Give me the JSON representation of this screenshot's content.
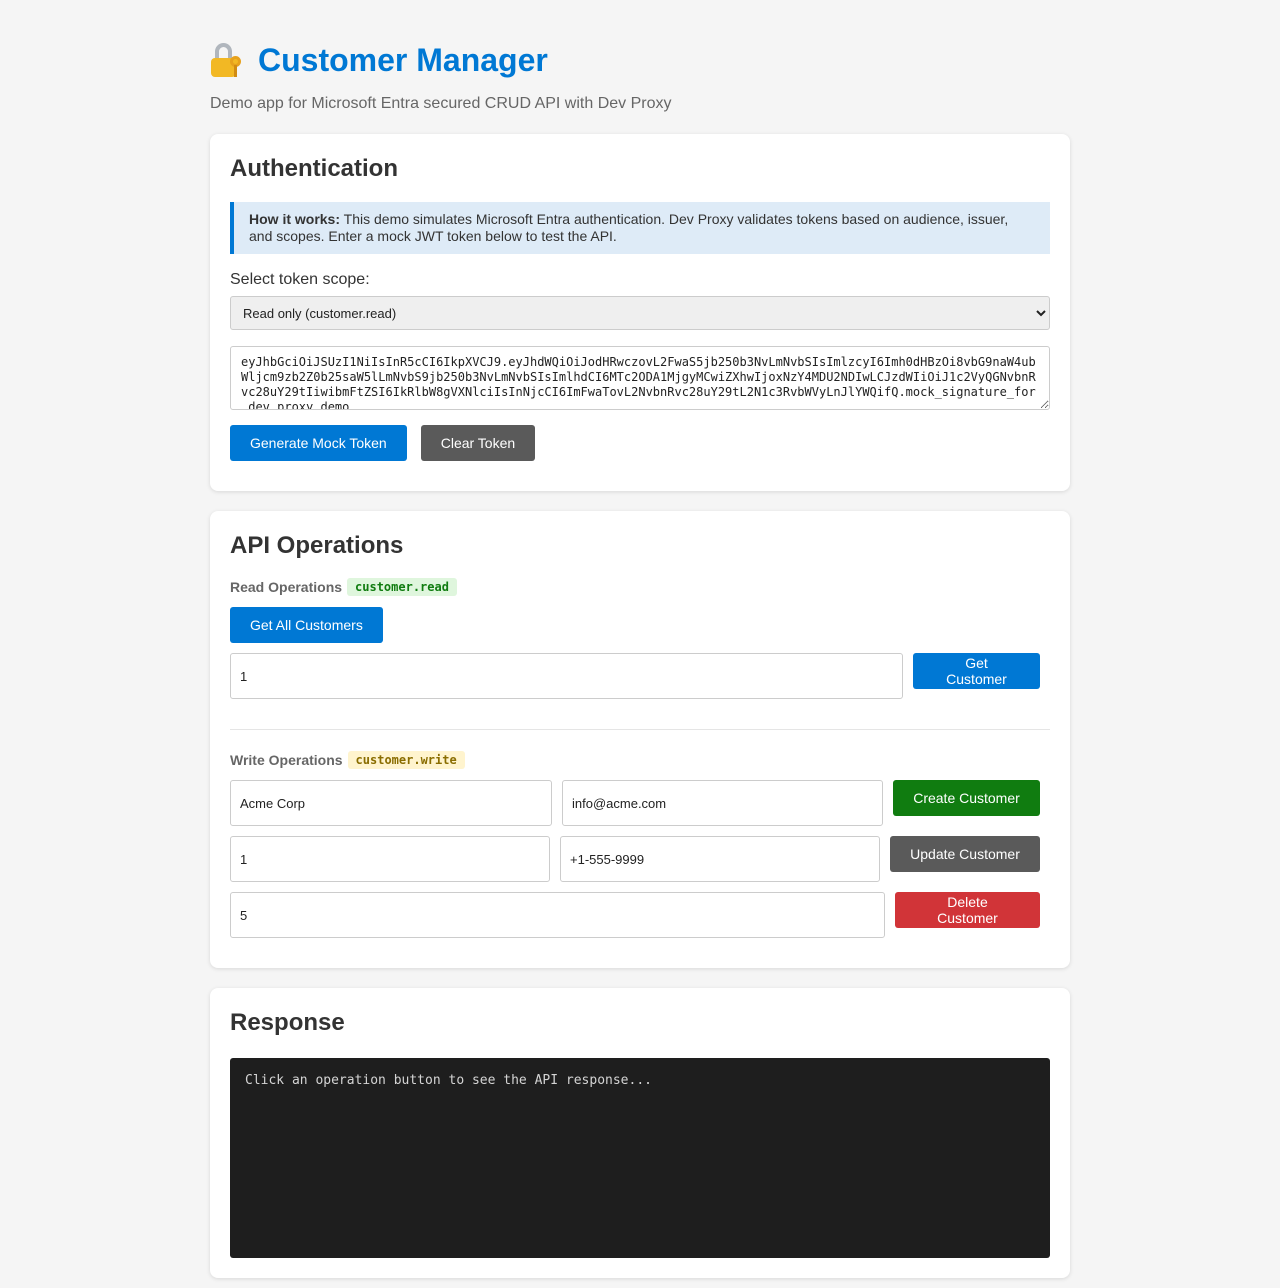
{
  "header": {
    "title": "Customer Manager",
    "subtitle": "Demo app for Microsoft Entra secured CRUD API with Dev Proxy"
  },
  "auth": {
    "heading": "Authentication",
    "info_bold": "How it works:",
    "info_text": " This demo simulates Microsoft Entra authentication. Dev Proxy validates tokens based on audience, issuer, and scopes. Enter a mock JWT token below to test the API.",
    "scope_label": "Select token scope:",
    "scope_selected": "Read only (customer.read)",
    "token_value": "eyJhbGciOiJSUzI1NiIsInR5cCI6IkpXVCJ9.eyJhdWQiOiJodHRwczovL2FwaS5jb250b3NvLmNvbSIsImlzcyI6Imh0dHBzOi8vbG9naW4ubWljcm9zb2Z0b25saW5lLmNvbS9jb250b3NvLmNvbSIsImlhdCI6MTc2ODA1MjgyMCwiZXhwIjoxNzY4MDU2NDIwLCJzdWIiOiJ1c2VyQGNvbnRvc28uY29tIiwibmFtZSI6IkRlbW8gVXNlciIsInNjcCI6ImFwaTovL2NvbnRvc28uY29tL2N1c3RvbWVyLnJlYWQifQ.mock_signature_for_dev_proxy_demo",
    "generate_label": "Generate Mock Token",
    "clear_label": "Clear Token"
  },
  "api": {
    "heading": "API Operations",
    "read_label": "Read Operations",
    "read_scope": "customer.read",
    "get_all_label": "Get All Customers",
    "get_id_value": "1",
    "get_customer_label": "Get Customer",
    "write_label": "Write Operations",
    "write_scope": "customer.write",
    "create_name_value": "Acme Corp",
    "create_email_value": "info@acme.com",
    "create_label": "Create Customer",
    "update_id_value": "1",
    "update_phone_value": "+1-555-9999",
    "update_label": "Update Customer",
    "delete_id_value": "5",
    "delete_label": "Delete Customer"
  },
  "response": {
    "heading": "Response",
    "placeholder": "Click an operation button to see the API response..."
  },
  "colors": {
    "accent": "#0078d4",
    "success": "#107c10",
    "danger": "#d13438",
    "neutral": "#5a5a5a"
  }
}
